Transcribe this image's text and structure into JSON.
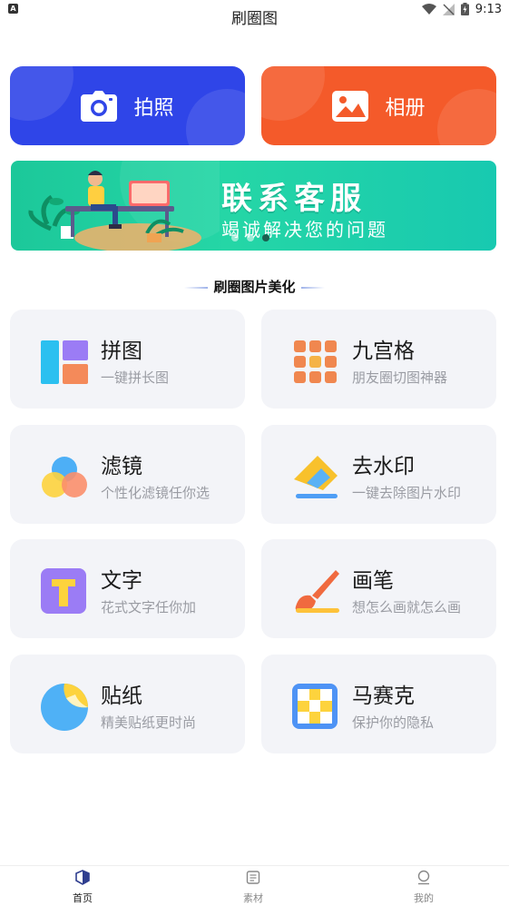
{
  "status_bar": {
    "time": "9:13",
    "left_badge": "A"
  },
  "header": {
    "title": "刷圈图"
  },
  "actions": {
    "camera_label": "拍照",
    "album_label": "相册"
  },
  "banner": {
    "title": "联系客服",
    "subtitle": "竭诚解决您的问题",
    "page_count": 3,
    "active_page": 3
  },
  "section": {
    "title": "刷圈图片美化"
  },
  "tools": [
    {
      "name": "拼图",
      "desc": "一键拼长图",
      "icon": "collage-icon"
    },
    {
      "name": "九宫格",
      "desc": "朋友圈切图神器",
      "icon": "grid-icon"
    },
    {
      "name": "滤镜",
      "desc": "个性化滤镜任你选",
      "icon": "filter-icon"
    },
    {
      "name": "去水印",
      "desc": "一键去除图片水印",
      "icon": "eraser-icon"
    },
    {
      "name": "文字",
      "desc": "花式文字任你加",
      "icon": "text-icon"
    },
    {
      "name": "画笔",
      "desc": "想怎么画就怎么画",
      "icon": "brush-icon"
    },
    {
      "name": "贴纸",
      "desc": "精美贴纸更时尚",
      "icon": "sticker-icon"
    },
    {
      "name": "马赛克",
      "desc": "保护你的隐私",
      "icon": "mosaic-icon"
    }
  ],
  "tab_bar": [
    {
      "label": "首页",
      "icon": "home-icon",
      "active": true
    },
    {
      "label": "素材",
      "icon": "materials-icon",
      "active": false
    },
    {
      "label": "我的",
      "icon": "profile-icon",
      "active": false
    }
  ],
  "colors": {
    "camera_button": "#2f45e8",
    "album_button": "#f45a2a",
    "banner": "#22d2a4",
    "card_bg": "#f3f4f8"
  }
}
